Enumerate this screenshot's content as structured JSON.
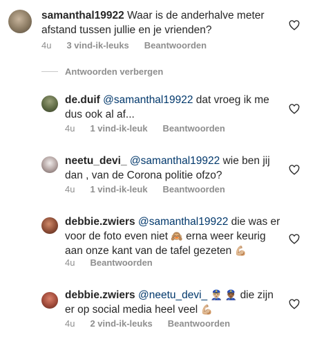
{
  "comments": [
    {
      "username": "samanthal19922",
      "mention": "",
      "text_after": "Waar is de anderhalve meter",
      "line2": "afstand tussen jullie en je vrienden?",
      "time": "4u",
      "likes": "3 vind-ik-leuks",
      "reply": "Beantwoorden"
    },
    {
      "username": "de.duif",
      "mention": "@samanthal19922",
      "text_after": "dat vroeg ik me",
      "line2": "dus ook al af...",
      "time": "4u",
      "likes": "1 vind-ik-leuk",
      "reply": "Beantwoorden"
    },
    {
      "username": "neetu_devi_",
      "mention": "@samanthal19922",
      "text_after": "wie ben jij",
      "line2": "dan , van de Corona politie ofzo?",
      "time": "4u",
      "likes": "1 vind-ik-leuk",
      "reply": "Beantwoorden"
    },
    {
      "username": "debbie.zwiers",
      "mention": "@samanthal19922",
      "text_after": "die was er",
      "line2": "voor de foto even niet",
      "line2_emoji": "🙈",
      "line2_after": "erna weer keurig",
      "line3": "aan onze kant van de tafel gezeten",
      "line3_emoji": "💪🏼",
      "time": "4u",
      "reply": "Beantwoorden"
    },
    {
      "username": "debbie.zwiers",
      "mention": "@neetu_devi_",
      "emoji": "👮🏼‍♂️ 👮🏾‍♂️",
      "text_after": "die zijn",
      "line2": "er op social media heel veel",
      "line2_emoji": "💪🏼",
      "time": "4u",
      "likes": "2 vind-ik-leuks",
      "reply": "Beantwoorden"
    }
  ],
  "replies_toggle": "Antwoorden verbergen",
  "icons": {
    "like": "heart-outline-icon"
  }
}
